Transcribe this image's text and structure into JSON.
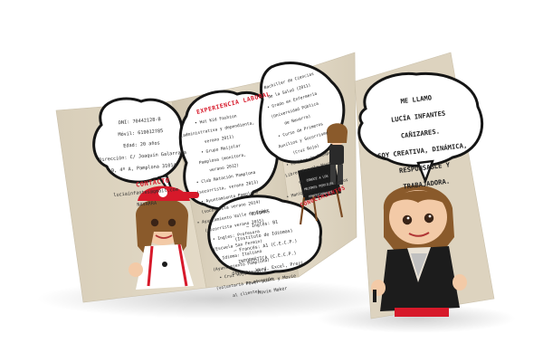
{
  "brochure": {
    "contact_lines": [
      "DNI: 70442128-B",
      "Móvil: 619012785",
      "Edad: 20 años",
      "Dirección: C/ Joaquín Galarraga",
      "9, 4º A, Pamplona 31014",
      "",
      "luciainfantes@gmail.com",
      "NAVARRA"
    ],
    "contact_label": "CONTACTO",
    "experience_title": "EXPERIENCIA LABORAL",
    "experience_lines": [
      "• Hot Kid Fashion",
      "(administrativa y dependienta,",
      "verano 2011)",
      "• Grupo Maijolar",
      "Pamplona (monitora,",
      "verano 2012)",
      "• Club Natación Pamplona",
      "(socorrista, verano 2013)",
      "• Ayuntamiento Pamplona",
      "(socorrista verano 2014)",
      "• Ayuntamiento Valle de Egüés",
      "(socorrista verano 2015)",
      "• Ingles: Profesora",
      "(Escuela San Fermin)",
      "• Idioma: Italiano",
      "(Ayuntamiento Pamplona)",
      "• Cruz Roja Navarra",
      "(voluntaria en atención",
      "al cliente)"
    ],
    "formation_lines": [
      "• Bachiller de Ciencias",
      "de la Salud (2011)",
      "• Grado en Enfermería",
      "(Universidad Pública",
      "de Navarra)",
      "• Curso de Primeros",
      "Auxilios y Socorrismo",
      "(Cruz Roja)",
      "• Monitor de Tiempo",
      "Libre (Escuela Navarra",
      "de Animación)",
      "• Manipulador de alimentos"
    ],
    "skills_title": "IDIOMAS",
    "skills_lines": [
      "– Inglés: B1",
      "(Instituto de Idiomas)",
      "– Francés: A1 (C.E.C.P.)",
      "INFORMÁTICA (C.E.C.P.)",
      "Office , Word, Excel, Prezi,",
      "Power point y Movie",
      "Movie Maker"
    ],
    "skills_label": "CONOCIMIENTOS",
    "board_lines": [
      "CONOCE A LOS",
      "MEJORES PERFILES",
      "PROFESIONALES"
    ]
  },
  "flyer": {
    "bubble_lines": [
      "ME LLAMO",
      "LUCÍA INFANTES",
      "CAÑIZARES.",
      "SOY CREATIVA, DINÁMICA,",
      "RESPONSABLE Y",
      "TRABAJADORA."
    ]
  },
  "colors": {
    "panel_beige": "#ddd3bf",
    "accent_red": "#d7192a",
    "hair_brown": "#8a5a2b",
    "jacket_black": "#1c1c1c"
  }
}
